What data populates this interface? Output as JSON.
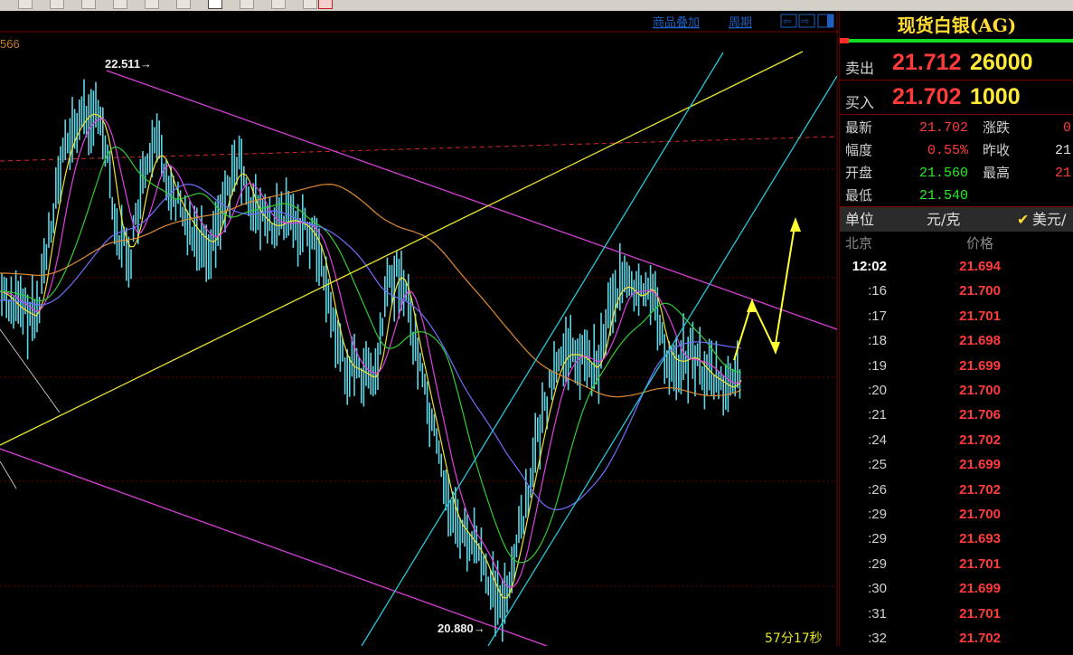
{
  "toolbar": {
    "button_count": 11
  },
  "chart": {
    "overlay_link": "商品叠加",
    "period_link": "周期",
    "left_edge_label": "566",
    "high_label": "22.511→",
    "low_label": "20.880→",
    "countdown": "57分17秒"
  },
  "panel": {
    "title": "现货白银(AG)",
    "sell_label": "卖出",
    "sell_price": "21.712",
    "sell_volume": "26000",
    "buy_label": "买入",
    "buy_price": "21.702",
    "buy_volume": "1000",
    "info": [
      {
        "label": "最新",
        "value": "21.702",
        "value_color": "#ff3b3b",
        "label2": "涨跌",
        "value2": "0",
        "value2_color": "#ff3b3b"
      },
      {
        "label": "幅度",
        "value": "0.55%",
        "value_color": "#ff3b3b",
        "label2": "昨收",
        "value2": "21",
        "value2_color": "#e0e0e0"
      },
      {
        "label": "开盘",
        "value": "21.560",
        "value_color": "#22ee22",
        "label2": "最高",
        "value2": "21",
        "value2_color": "#ff3b3b"
      },
      {
        "label": "最低",
        "value": "21.540",
        "value_color": "#22ee22",
        "label2": "",
        "value2": "",
        "value2_color": "#e0e0e0"
      }
    ],
    "unit_label": "单位",
    "unit_value": "元/克",
    "currency_label": "美元/",
    "ticks_time_header": "北京",
    "ticks_price_header": "价格",
    "ticks": [
      {
        "time": "12:02",
        "price": "21.694"
      },
      {
        "time": ":16",
        "price": "21.700"
      },
      {
        "time": ":17",
        "price": "21.701"
      },
      {
        "time": ":18",
        "price": "21.698"
      },
      {
        "time": ":19",
        "price": "21.699"
      },
      {
        "time": ":20",
        "price": "21.700"
      },
      {
        "time": ":21",
        "price": "21.706"
      },
      {
        "time": ":24",
        "price": "21.702"
      },
      {
        "time": ":25",
        "price": "21.699"
      },
      {
        "time": ":26",
        "price": "21.702"
      },
      {
        "time": ":29",
        "price": "21.700"
      },
      {
        "time": ":29",
        "price": "21.693"
      },
      {
        "time": ":29",
        "price": "21.701"
      },
      {
        "time": ":30",
        "price": "21.699"
      },
      {
        "time": ":31",
        "price": "21.701"
      },
      {
        "time": ":32",
        "price": "21.702"
      }
    ]
  },
  "colors": {
    "candles": "#5fd6e6",
    "ma_yellow": "#f2e233",
    "ma_magenta": "#e040e0",
    "ma_green": "#33cc33",
    "ma_blue": "#6f6fff",
    "ma_orange": "#e08a30",
    "channel_magenta": "#d63fd6",
    "channel_cyan": "#27c7d6",
    "trend_yellow": "#e6e62e",
    "arrow_yellow": "#ffff33"
  }
}
